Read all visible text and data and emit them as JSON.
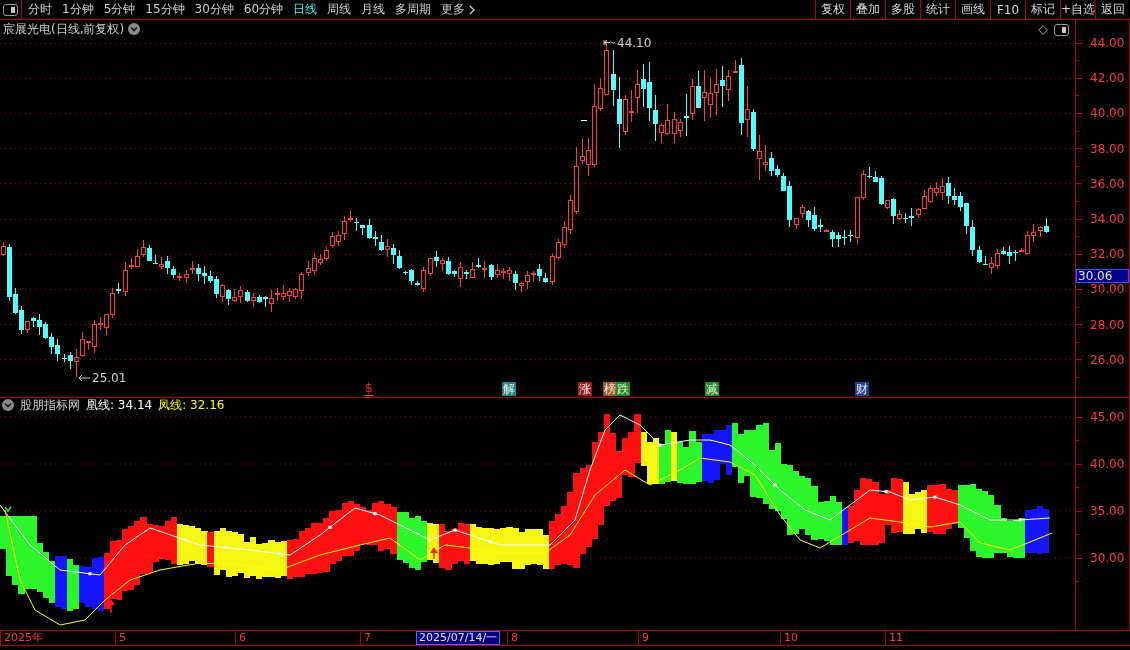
{
  "toolbar": {
    "period_tabs": [
      {
        "label": "分时",
        "selected": false
      },
      {
        "label": "1分钟",
        "selected": false
      },
      {
        "label": "5分钟",
        "selected": false
      },
      {
        "label": "15分钟",
        "selected": false
      },
      {
        "label": "30分钟",
        "selected": false
      },
      {
        "label": "60分钟",
        "selected": false
      },
      {
        "label": "日线",
        "selected": true
      },
      {
        "label": "周线",
        "selected": false
      },
      {
        "label": "月线",
        "selected": false
      },
      {
        "label": "多周期",
        "selected": false
      }
    ],
    "more": "更多",
    "buttons": [
      "复权",
      "叠加",
      "多股",
      "统计",
      "画线",
      "F10",
      "标记",
      "+自选",
      "返回"
    ]
  },
  "main_chart": {
    "title": "宸展光电(日线,前复权)",
    "high_label": "44.10",
    "low_label": "25.01",
    "event_markers": [
      {
        "label": "$",
        "kind": "text",
        "color": "#ff2828"
      },
      {
        "label": "解",
        "kind": "tag",
        "color": "#1b8585"
      },
      {
        "label": "涨",
        "kind": "tag",
        "color": "#9b1b1b"
      },
      {
        "label": "榜",
        "kind": "tag",
        "color": "#a05a20"
      },
      {
        "label": "跌",
        "kind": "tag",
        "color": "#1e8c1e"
      },
      {
        "label": "减",
        "kind": "tag",
        "color": "#1e8c1e"
      },
      {
        "label": "财",
        "kind": "tag",
        "color": "#1c3f8f"
      }
    ],
    "price_axis": [
      "44.00",
      "42.00",
      "40.00",
      "38.00",
      "36.00",
      "34.00",
      "32.00",
      "30.00",
      "28.00",
      "26.00"
    ],
    "current_price": "30.06"
  },
  "indicator": {
    "name": "股朋指标网",
    "lines": [
      {
        "label": "凰线: 34.14",
        "color": "#ffffff"
      },
      {
        "label": "凤线: 32.16",
        "color": "#ffff00"
      }
    ],
    "value_axis": [
      "45.00",
      "40.00",
      "35.00",
      "30.00"
    ]
  },
  "time_axis": {
    "labels": [
      "2025年",
      "5",
      "6",
      "7",
      "8",
      "9",
      "10",
      "11"
    ],
    "cursor_date": "2025/07/14/一"
  }
}
